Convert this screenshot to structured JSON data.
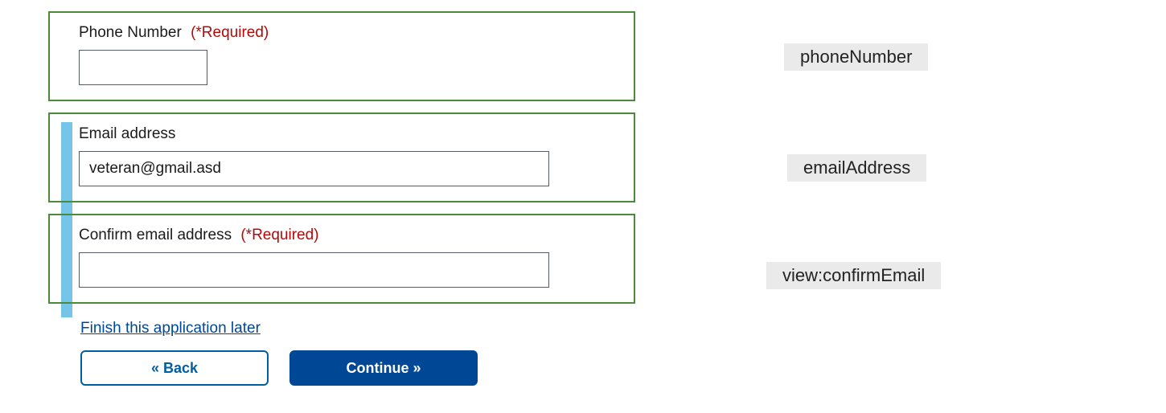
{
  "fields": {
    "phone": {
      "label": "Phone Number",
      "required_text": "(*Required)",
      "value": ""
    },
    "email": {
      "label": "Email address",
      "value": "veteran@gmail.asd"
    },
    "confirm_email": {
      "label": "Confirm email address",
      "required_text": "(*Required)",
      "value": ""
    }
  },
  "actions": {
    "finish_later": "Finish this application later",
    "back": "« Back",
    "continue": "Continue »"
  },
  "annotations": {
    "phone": "phoneNumber",
    "email": "emailAddress",
    "confirm_email": "view:confirmEmail"
  }
}
